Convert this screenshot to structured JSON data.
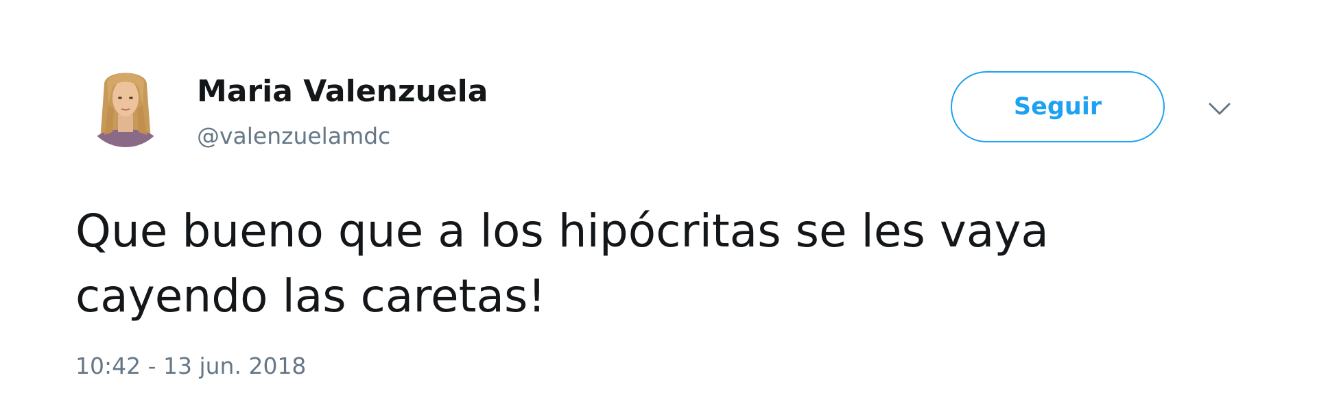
{
  "user": {
    "display_name": "Maria Valenzuela",
    "handle": "@valenzuelamdc",
    "avatar_icon": "profile-photo"
  },
  "actions": {
    "follow_label": "Seguir",
    "menu_icon": "chevron-down-icon"
  },
  "tweet": {
    "line1": "Que bueno que a los hipócritas se les vaya",
    "line2": "cayendo las caretas!",
    "timestamp": "10:42 - 13 jun. 2018"
  },
  "colors": {
    "accent": "#1da1f2",
    "text": "#14171a",
    "secondary_text": "#657786",
    "background": "#ffffff"
  }
}
